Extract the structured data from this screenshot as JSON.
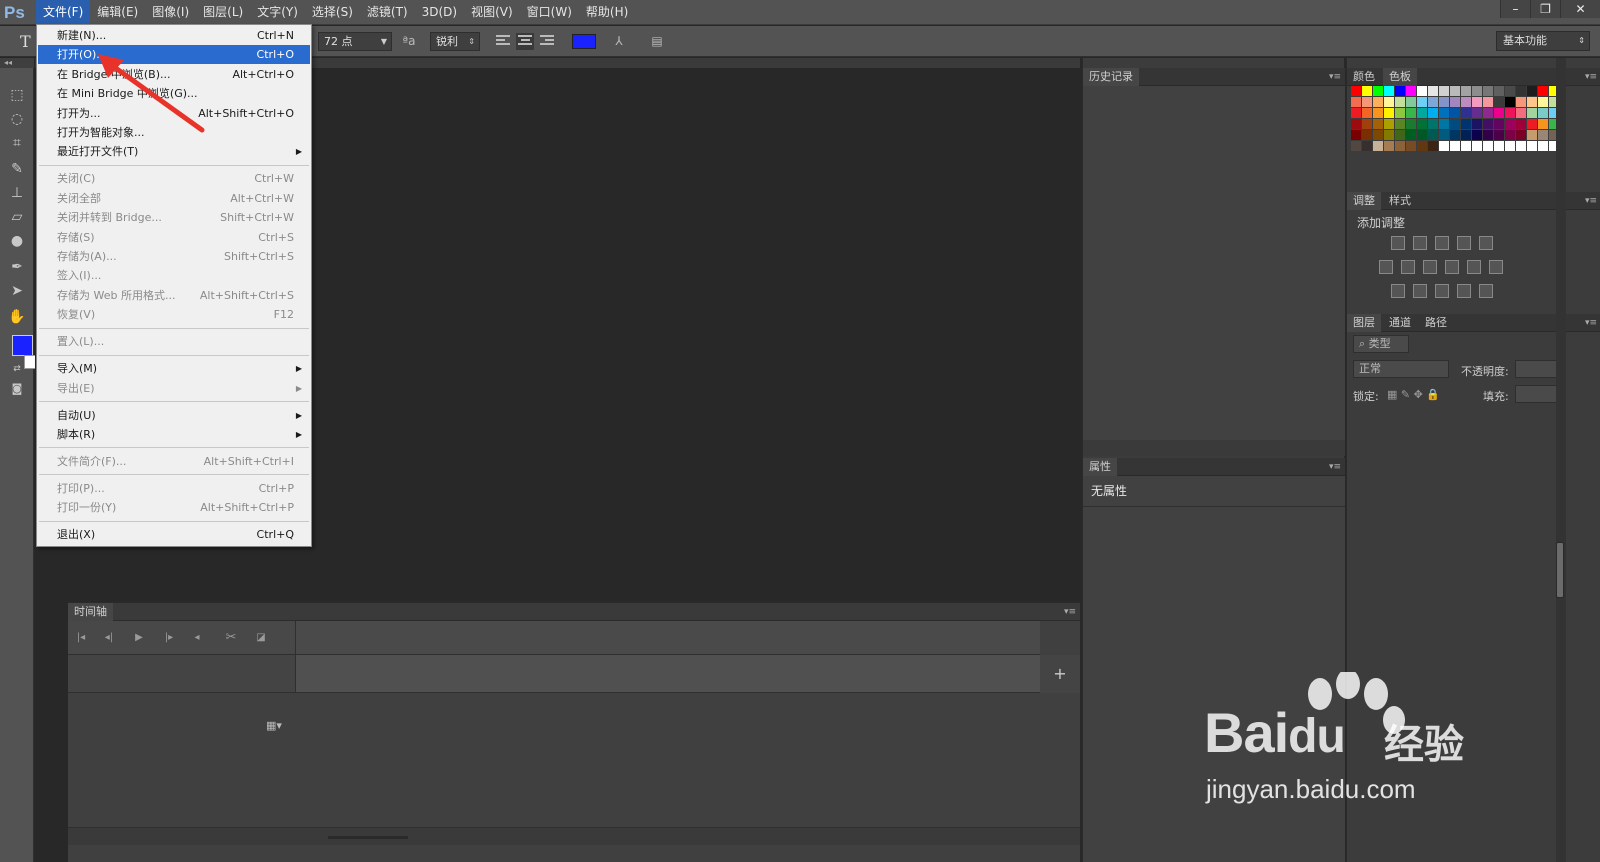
{
  "app": {
    "logo": "Ps"
  },
  "menubar": {
    "items": [
      "文件(F)",
      "编辑(E)",
      "图像(I)",
      "图层(L)",
      "文字(Y)",
      "选择(S)",
      "滤镜(T)",
      "3D(D)",
      "视图(V)",
      "窗口(W)",
      "帮助(H)"
    ],
    "active_index": 0
  },
  "window_controls": {
    "minimize": "–",
    "restore": "❐",
    "close": "✕"
  },
  "options_bar": {
    "tool_glyph": "T",
    "font_size": "72 点",
    "aa_glyph": "ªa",
    "antialias": "锐利",
    "warp_glyph": "⅄",
    "panel_glyph": "▤",
    "text_color": "#1a22ff",
    "workspace": "基本功能"
  },
  "file_menu": {
    "items": [
      {
        "label": "新建(N)...",
        "shortcut": "Ctrl+N",
        "enabled": true
      },
      {
        "label": "打开(O)...",
        "shortcut": "Ctrl+O",
        "enabled": true,
        "highlighted": true
      },
      {
        "label": "在 Bridge 中浏览(B)...",
        "shortcut": "Alt+Ctrl+O",
        "enabled": true
      },
      {
        "label": "在 Mini Bridge 中浏览(G)...",
        "shortcut": "",
        "enabled": true
      },
      {
        "label": "打开为...",
        "shortcut": "Alt+Shift+Ctrl+O",
        "enabled": true
      },
      {
        "label": "打开为智能对象...",
        "shortcut": "",
        "enabled": true
      },
      {
        "label": "最近打开文件(T)",
        "shortcut": "",
        "enabled": true,
        "submenu": true
      },
      {
        "label": "关闭(C)",
        "shortcut": "Ctrl+W",
        "enabled": false
      },
      {
        "label": "关闭全部",
        "shortcut": "Alt+Ctrl+W",
        "enabled": false
      },
      {
        "label": "关闭并转到 Bridge...",
        "shortcut": "Shift+Ctrl+W",
        "enabled": false
      },
      {
        "label": "存储(S)",
        "shortcut": "Ctrl+S",
        "enabled": false
      },
      {
        "label": "存储为(A)...",
        "shortcut": "Shift+Ctrl+S",
        "enabled": false
      },
      {
        "label": "签入(I)...",
        "shortcut": "",
        "enabled": false
      },
      {
        "label": "存储为 Web 所用格式...",
        "shortcut": "Alt+Shift+Ctrl+S",
        "enabled": false
      },
      {
        "label": "恢复(V)",
        "shortcut": "F12",
        "enabled": false
      },
      {
        "label": "置入(L)...",
        "shortcut": "",
        "enabled": false
      },
      {
        "label": "导入(M)",
        "shortcut": "",
        "enabled": true,
        "submenu": true
      },
      {
        "label": "导出(E)",
        "shortcut": "",
        "enabled": false,
        "submenu": true
      },
      {
        "label": "自动(U)",
        "shortcut": "",
        "enabled": true,
        "submenu": true
      },
      {
        "label": "脚本(R)",
        "shortcut": "",
        "enabled": true,
        "submenu": true
      },
      {
        "label": "文件简介(F)...",
        "shortcut": "Alt+Shift+Ctrl+I",
        "enabled": false
      },
      {
        "label": "打印(P)...",
        "shortcut": "Ctrl+P",
        "enabled": false
      },
      {
        "label": "打印一份(Y)",
        "shortcut": "Alt+Shift+Ctrl+P",
        "enabled": false
      },
      {
        "label": "退出(X)",
        "shortcut": "Ctrl+Q",
        "enabled": true
      }
    ]
  },
  "timeline": {
    "title": "时间轴",
    "add": "+"
  },
  "history": {
    "title": "历史记录"
  },
  "properties": {
    "title": "属性",
    "value": "无属性"
  },
  "color_panel": {
    "tabs": [
      "颜色",
      "色板"
    ],
    "active_index": 1
  },
  "adjustments": {
    "tabs": [
      "调整",
      "样式"
    ],
    "heading": "添加调整"
  },
  "layers": {
    "tabs": [
      "图层",
      "通道",
      "路径"
    ],
    "filter": "类型",
    "blend_mode": "正常",
    "opacity_label": "不透明度:",
    "lock_label": "锁定:",
    "fill_label": "填充:"
  },
  "swatches": [
    "#ff0000",
    "#ffff00",
    "#00ff00",
    "#00ffff",
    "#0000ff",
    "#ff00ff",
    "#ffffff",
    "#e6e6e6",
    "#d0d0d0",
    "#bababa",
    "#a3a3a3",
    "#8d8d8d",
    "#777777",
    "#606060",
    "#4a4a4a",
    "#333333",
    "#1d1d1d",
    "#ff0000",
    "#ffff00",
    "#f26c4f",
    "#f69679",
    "#fbaf5d",
    "#fff799",
    "#c4df9b",
    "#82ca9c",
    "#6dcff6",
    "#7ea7d8",
    "#8493ca",
    "#a187be",
    "#bd8cbf",
    "#f49ac1",
    "#f5989d",
    "#3b3b3b",
    "#000000",
    "#f7977a",
    "#fdc68a",
    "#fff79a",
    "#c4df9b",
    "#ed1c24",
    "#f26522",
    "#f7941d",
    "#fff200",
    "#8dc63f",
    "#39b54a",
    "#00a99d",
    "#00aeef",
    "#0072bc",
    "#0054a6",
    "#2e3192",
    "#662d91",
    "#92278f",
    "#ec008c",
    "#ed145b",
    "#f26d7d",
    "#a2d39c",
    "#7accc8",
    "#6dcff6",
    "#9e0b0f",
    "#a0410d",
    "#a36209",
    "#aba000",
    "#598527",
    "#1a7b30",
    "#007236",
    "#00746b",
    "#0076a3",
    "#004b80",
    "#003471",
    "#1b1464",
    "#440e62",
    "#630460",
    "#9e005d",
    "#9e0039",
    "#ed1c24",
    "#f7941d",
    "#39b54a",
    "#790000",
    "#7b2e00",
    "#7d4900",
    "#827b00",
    "#406618",
    "#005e20",
    "#005826",
    "#005952",
    "#005b7f",
    "#003663",
    "#002157",
    "#0d004c",
    "#32004b",
    "#4b0049",
    "#7b0046",
    "#7a0026",
    "#c69c6d",
    "#998675",
    "#736357",
    "#534741",
    "#362f2d",
    "#c7b299",
    "#a67c52",
    "#8c6239",
    "#754c24",
    "#603913",
    "#3c2415",
    "#ffffff",
    "#ffffff",
    "#ffffff",
    "#ffffff",
    "#ffffff",
    "#ffffff",
    "#ffffff",
    "#ffffff",
    "#ffffff",
    "#ffffff",
    "#ffffff"
  ],
  "watermark": {
    "brand": "Bai",
    "brand2": "du",
    "cn": "经验",
    "url": "jingyan.baidu.com"
  },
  "tool_colors": {
    "foreground": "#1a22ff",
    "background": "#ffffff"
  }
}
